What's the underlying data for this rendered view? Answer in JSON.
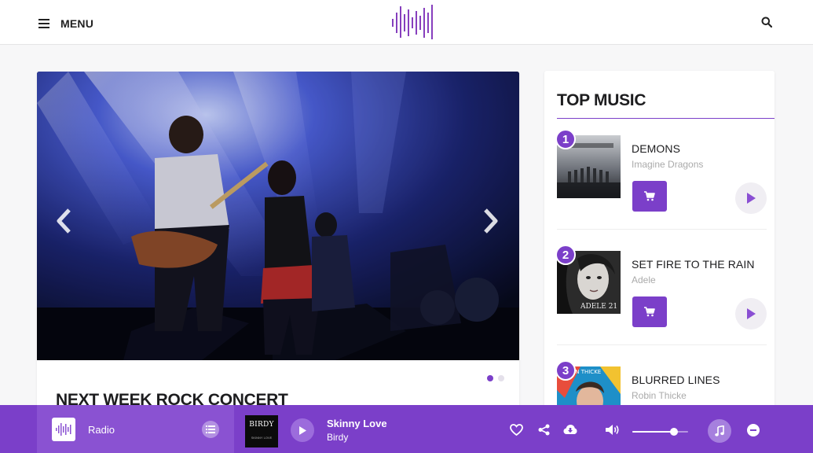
{
  "header": {
    "menu_label": "MENU",
    "logo_icon": "sound-wave-logo",
    "search_icon": "search-icon"
  },
  "hero": {
    "image_subject": "rock-concert-stage-photo",
    "title": "NEXT WEEK ROCK CONCERT",
    "slides_total": 2,
    "active_slide": 1
  },
  "top_music": {
    "title": "TOP MUSIC",
    "tracks": [
      {
        "rank": "1",
        "name": "DEMONS",
        "artist": "Imagine Dragons"
      },
      {
        "rank": "2",
        "name": "SET FIRE TO THE RAIN",
        "artist": "Adele"
      },
      {
        "rank": "3",
        "name": "BLURRED LINES",
        "artist": "Robin Thicke"
      }
    ]
  },
  "player": {
    "radio_label": "Radio",
    "now_playing": {
      "title": "Skinny Love",
      "artist": "Birdy",
      "art_text": "BIRDY",
      "art_subtext": "SKINNY LOVE"
    },
    "volume": 0.75
  },
  "colors": {
    "accent": "#7b3fc9",
    "radio_box": "#8a52d2"
  }
}
